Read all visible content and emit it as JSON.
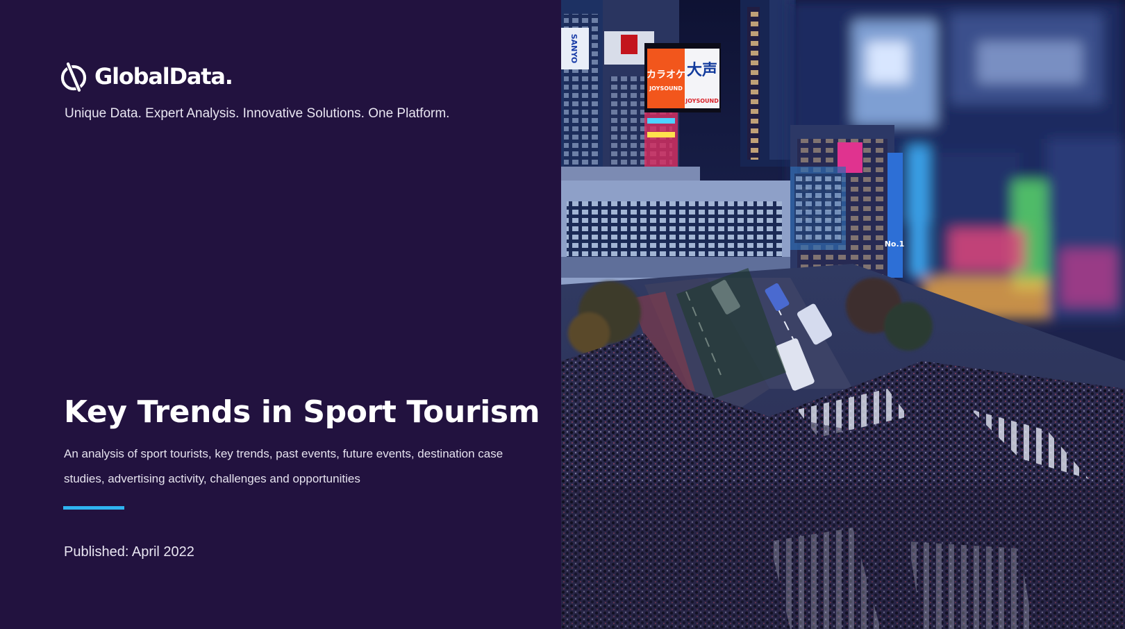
{
  "brand": {
    "logo_text": "GlobalData.",
    "tagline": "Unique Data. Expert Analysis. Innovative Solutions. One Platform."
  },
  "report": {
    "title": "Key Trends in Sport Tourism",
    "subtitle": "An analysis of sport tourists, key trends, past events, future events, destination case studies, advertising activity, challenges and opportunities",
    "published": "Published: April 2022"
  },
  "cover_image": {
    "signs": [
      "カラオケ",
      "JOYSOUND",
      "大声",
      "JOYSOUND",
      "SANYO",
      "No.1"
    ]
  },
  "colors": {
    "background": "#22123f",
    "accent": "#2fb3f0",
    "text": "#ffffff"
  }
}
